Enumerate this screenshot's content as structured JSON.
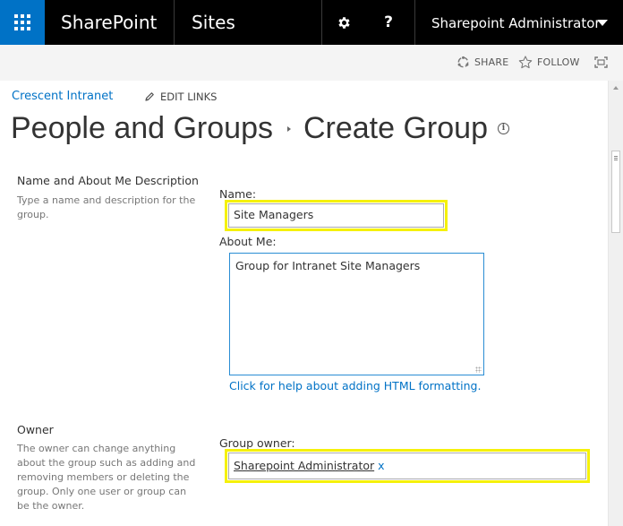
{
  "suite_bar": {
    "brand": "SharePoint",
    "app": "Sites",
    "settings_icon": "gear-icon",
    "help_label": "?",
    "user_name": "Sharepoint Administrator"
  },
  "ribbon": {
    "share_label": "SHARE",
    "follow_label": "FOLLOW",
    "focus_icon": "focus-on-content-icon"
  },
  "nav": {
    "site_link": "Crescent Intranet",
    "edit_links_label": "EDIT LINKS"
  },
  "title": {
    "part1": "People and Groups",
    "part2": "Create Group"
  },
  "section_name": {
    "heading": "Name and About Me Description",
    "description": "Type a name and description for the group.",
    "name_label": "Name:",
    "name_value": "Site Managers",
    "about_label": "About Me:",
    "about_value": "Group for Intranet Site Managers",
    "help_link": "Click for help about adding HTML formatting."
  },
  "section_owner": {
    "heading": "Owner",
    "description": "The owner can change anything about the group such as adding and removing members or deleting the group. Only one user or group can be the owner.",
    "owner_label": "Group owner:",
    "owner_value": "Sharepoint Administrator",
    "remove_label": "x"
  },
  "colors": {
    "suite_bar": "#000000",
    "waffle": "#0072c6",
    "link": "#0072c6",
    "highlight": "#f5f10a"
  }
}
